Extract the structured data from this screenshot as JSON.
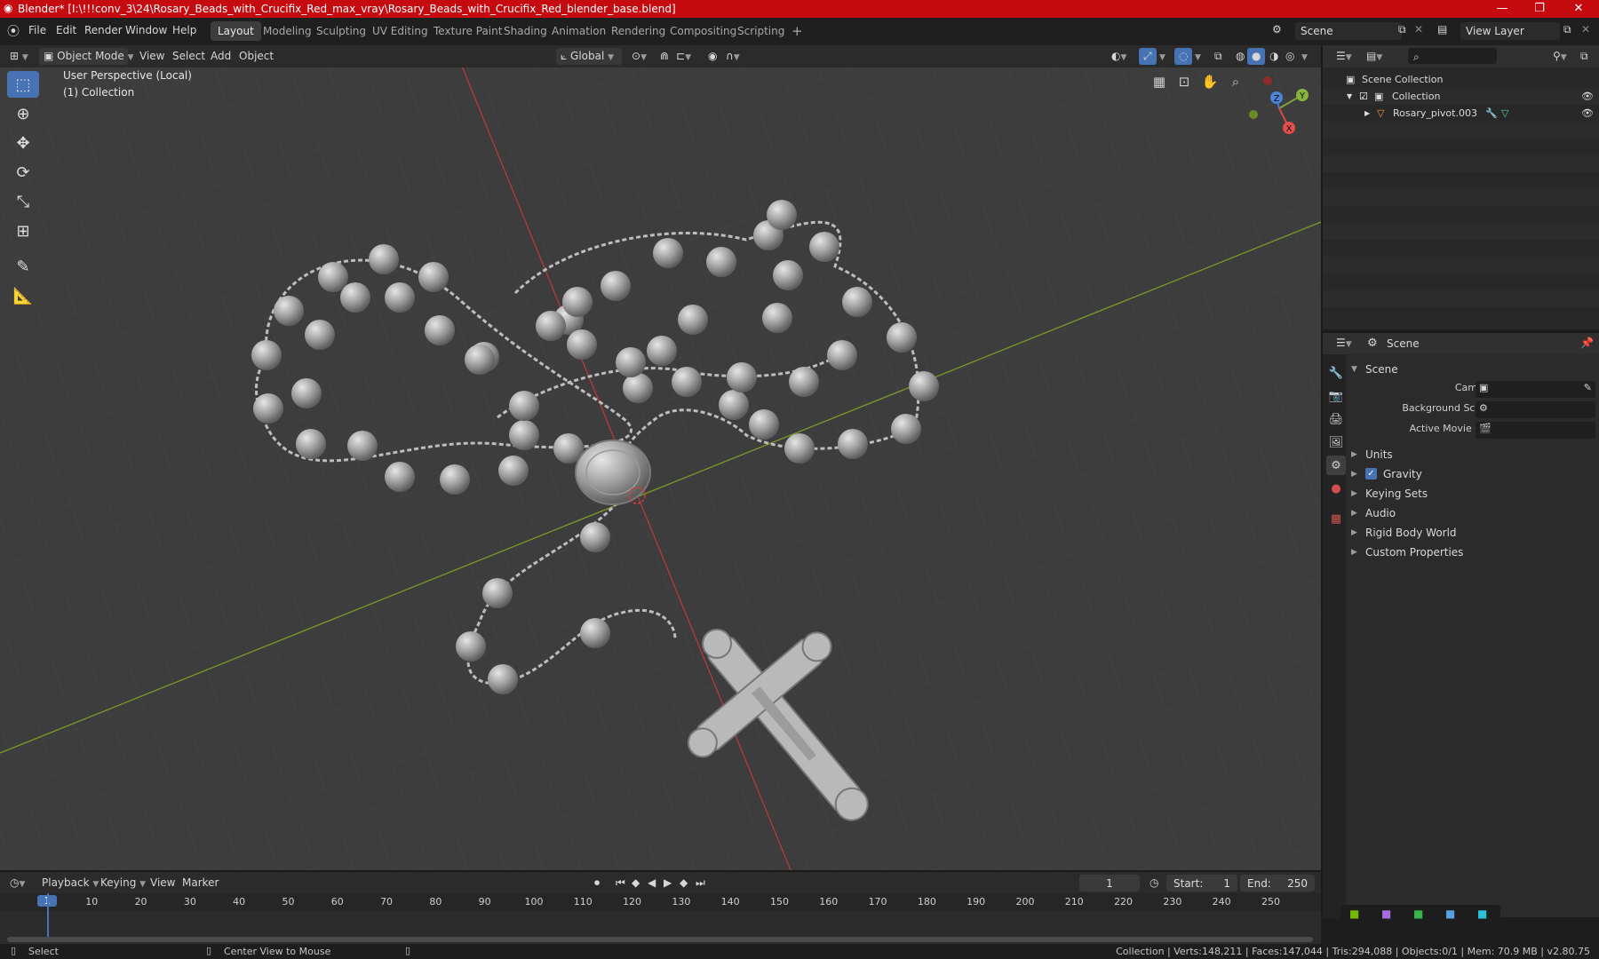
{
  "titlebar": {
    "title": "Blender* [I:\\!!!conv_3\\24\\Rosary_Beads_with_Crucifix_Red_max_vray\\Rosary_Beads_with_Crucifix_Red_blender_base.blend]",
    "minimize": "—",
    "maximize": "❐",
    "close": "✕"
  },
  "menu": [
    "File",
    "Edit",
    "Render",
    "Window",
    "Help"
  ],
  "workspaces": [
    "Layout",
    "Modeling",
    "Sculpting",
    "UV Editing",
    "Texture Paint",
    "Shading",
    "Animation",
    "Rendering",
    "Compositing",
    "Scripting"
  ],
  "workspace_add": "+",
  "active_workspace": "Layout",
  "scene_selector": "Scene",
  "view_layer": "View Layer",
  "viewport_header": {
    "mode": "Object Mode",
    "menus": [
      "View",
      "Select",
      "Add",
      "Object"
    ],
    "orientation": "Global"
  },
  "viewport": {
    "perspective_label": "User Perspective (Local)",
    "collection_label": "(1) Collection",
    "gizmo": {
      "x": "X",
      "y": "Y",
      "z": "Z"
    }
  },
  "toolbar_tools": [
    "select-box",
    "cursor",
    "move",
    "rotate",
    "scale",
    "transform",
    "annotate",
    "measure"
  ],
  "outliner": {
    "rows": [
      {
        "label": "Scene Collection",
        "indent": 0
      },
      {
        "label": "Collection",
        "indent": 1
      },
      {
        "label": "Rosary_pivot.003",
        "indent": 2
      }
    ]
  },
  "properties": {
    "header_title": "Scene",
    "panel_title": "Scene",
    "fields": [
      {
        "label": "Camera"
      },
      {
        "label": "Background Scene"
      },
      {
        "label": "Active Movie Clip"
      }
    ],
    "sections": [
      "Units",
      "Gravity",
      "Keying Sets",
      "Audio",
      "Rigid Body World",
      "Custom Properties"
    ]
  },
  "timeline": {
    "menus": [
      "Playback",
      "Keying",
      "View",
      "Marker"
    ],
    "current_frame": "1",
    "start_label": "Start:",
    "start": "1",
    "end_label": "End:",
    "end": "250",
    "ticks": [
      "1",
      "10",
      "20",
      "30",
      "40",
      "50",
      "60",
      "70",
      "80",
      "90",
      "100",
      "110",
      "120",
      "130",
      "140",
      "150",
      "160",
      "170",
      "180",
      "190",
      "200",
      "210",
      "220",
      "230",
      "240",
      "250"
    ]
  },
  "statusbar": {
    "left_action": "Select",
    "mid_action": "Center View to Mouse",
    "stats": "Collection | Verts:148,211 | Faces:147,044 | Tris:294,088 | Objects:0/1 | Mem: 70.9 MB | v2.80.75"
  }
}
